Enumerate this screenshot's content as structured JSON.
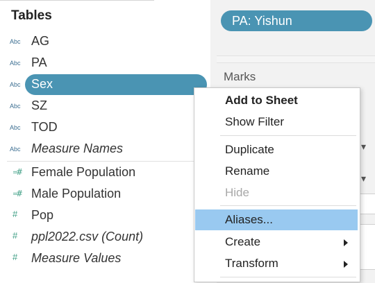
{
  "data_pane": {
    "title": "Tables",
    "dimension_icon": "Abc",
    "measure_icon": "#",
    "dimensions": [
      {
        "label": "AG",
        "italic": false
      },
      {
        "label": "PA",
        "italic": false
      },
      {
        "label": "Sex",
        "italic": false,
        "selected": true
      },
      {
        "label": "SZ",
        "italic": false
      },
      {
        "label": "TOD",
        "italic": false
      },
      {
        "label": "Measure Names",
        "italic": true
      }
    ],
    "measures": [
      {
        "label": "Female Population",
        "italic": false,
        "calculated": true
      },
      {
        "label": "Male Population",
        "italic": false,
        "calculated": true
      },
      {
        "label": "Pop",
        "italic": false
      },
      {
        "label": "ppl2022.csv (Count)",
        "italic": true
      },
      {
        "label": "Measure Values",
        "italic": true
      }
    ]
  },
  "filters": {
    "pill_label": "PA: Yishun"
  },
  "marks": {
    "title": "Marks"
  },
  "context_menu": {
    "items": [
      {
        "label": "Add to Sheet",
        "bold": true
      },
      {
        "label": "Show Filter"
      },
      {
        "label": "Duplicate"
      },
      {
        "label": "Rename"
      },
      {
        "label": "Hide",
        "disabled": true
      },
      {
        "label": "Aliases...",
        "highlighted": true
      },
      {
        "label": "Create",
        "submenu": true
      },
      {
        "label": "Transform",
        "submenu": true
      }
    ]
  },
  "colors": {
    "pill_blue": "#4a94b3",
    "menu_highlight": "#99c9f0",
    "dimension_icon": "#3d6f92",
    "measure_icon": "#3f9f85"
  }
}
